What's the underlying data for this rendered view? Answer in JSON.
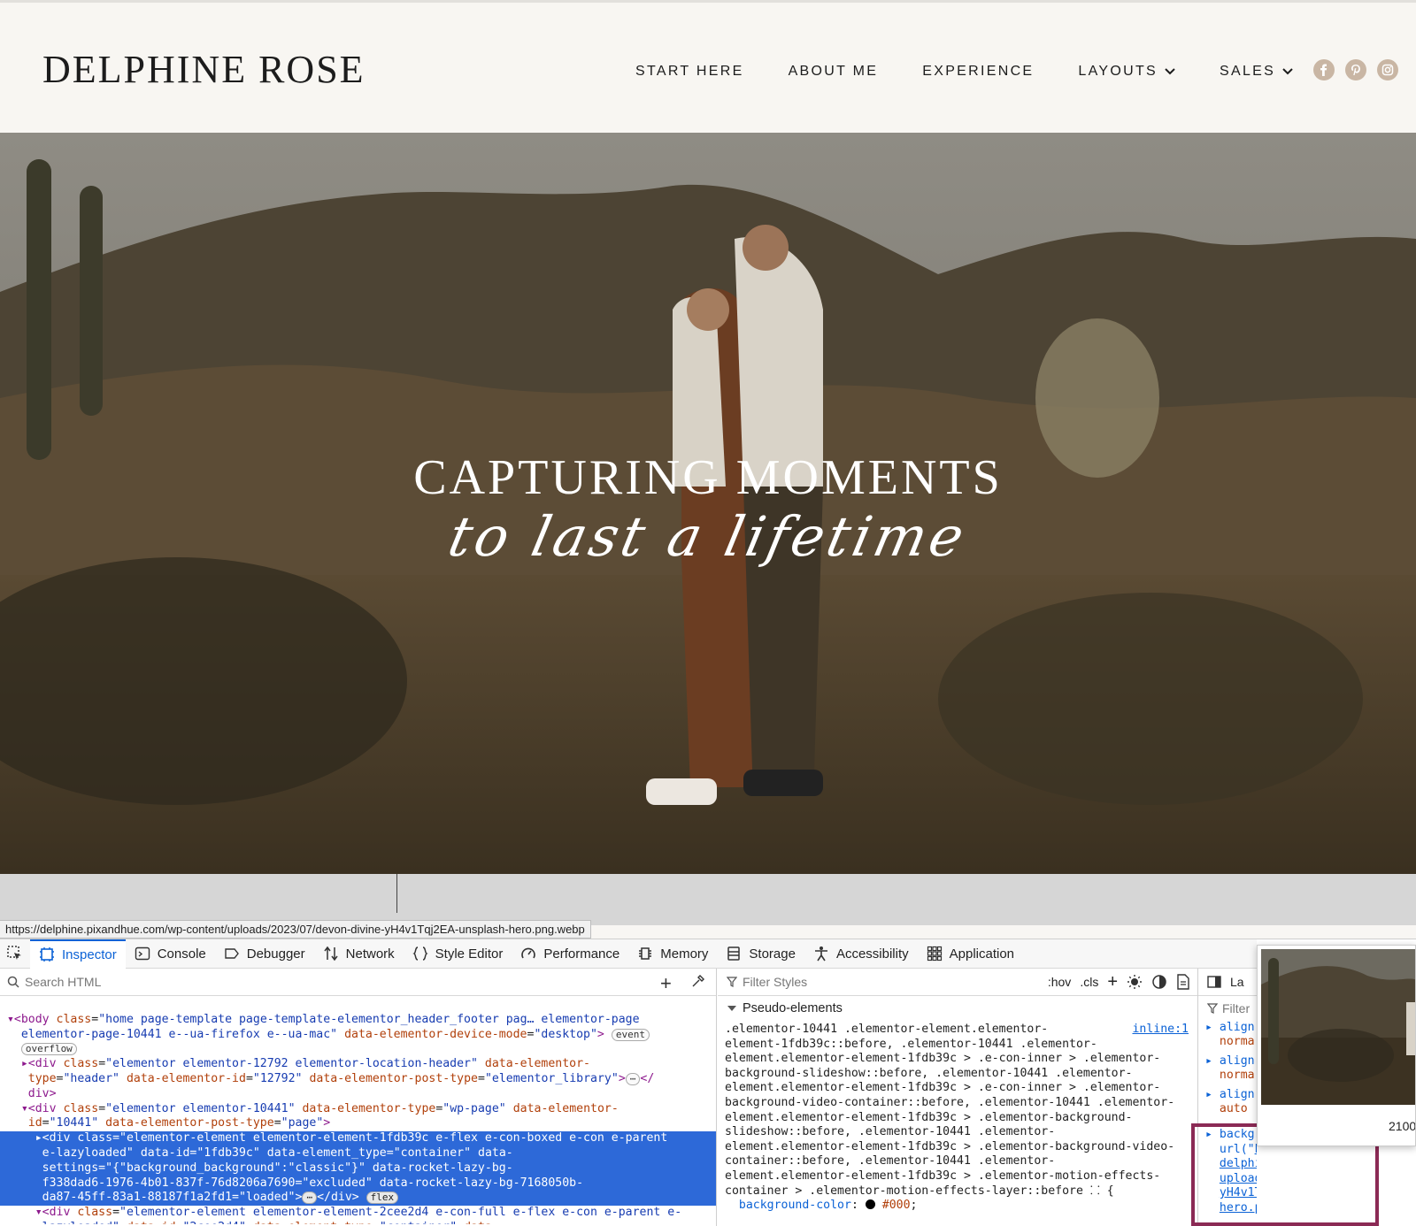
{
  "site": {
    "logo": "DELPHINE ROSE",
    "nav": [
      {
        "label": "START HERE",
        "dropdown": false
      },
      {
        "label": "ABOUT ME",
        "dropdown": false
      },
      {
        "label": "EXPERIENCE",
        "dropdown": false
      },
      {
        "label": "LAYOUTS",
        "dropdown": true
      },
      {
        "label": "SALES",
        "dropdown": true
      }
    ],
    "social_icons": [
      "facebook-icon",
      "pinterest-icon",
      "instagram-icon"
    ]
  },
  "hero": {
    "title": "CAPTURING MOMENTS",
    "script": "to last a lifetime"
  },
  "status_url": "https://delphine.pixandhue.com/wp-content/uploads/2023/07/devon-divine-yH4v1Tqj2EA-unsplash-hero.png.webp",
  "devtools": {
    "tabs": [
      "Inspector",
      "Console",
      "Debugger",
      "Network",
      "Style Editor",
      "Performance",
      "Memory",
      "Storage",
      "Accessibility",
      "Application"
    ],
    "active_tab": "Inspector",
    "search_placeholder": "Search HTML",
    "filter_placeholder": "Filter Styles",
    "hov": ":hov",
    "cls": ".cls",
    "pseudo_heading": "Pseudo-elements",
    "rule_source": "inline:1",
    "layout_label": "La",
    "rp_filter": "Filter",
    "thumb_dim": "2100"
  },
  "colors": {
    "selection": "#2d69d8",
    "highlight_box": "#8b2a55",
    "tab_active": "#0b62d6"
  }
}
